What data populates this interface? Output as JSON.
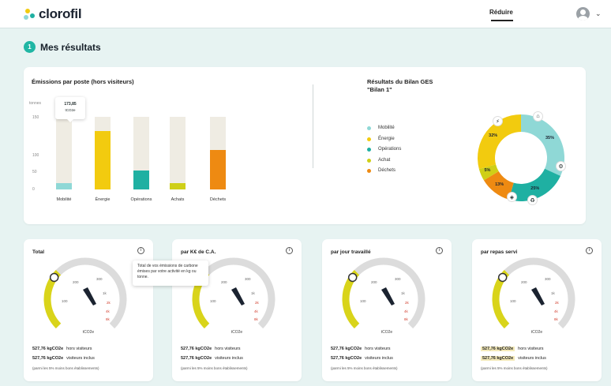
{
  "app": {
    "name": "clorofil"
  },
  "header": {
    "reduce_label": "Réduire"
  },
  "page": {
    "step": "1",
    "title": "Mes résultats"
  },
  "emissions": {
    "title": "Émissions par poste (hors visiteurs)",
    "y_ticks": [
      "tonnes",
      "150",
      "100",
      "50",
      "0"
    ],
    "tooltip": {
      "value": "173,85",
      "unit": "tCO2e"
    }
  },
  "ges": {
    "title_line1": "Résultats du Bilan GES",
    "title_line2": "\"Bilan 1\"",
    "legend": [
      {
        "label": "Mobilité",
        "color": "#8fd8d6"
      },
      {
        "label": "Énergie",
        "color": "#f2cb0f"
      },
      {
        "label": "Opérations",
        "color": "#1fb0a2"
      },
      {
        "label": "Achat",
        "color": "#cfcf17"
      },
      {
        "label": "Déchets",
        "color": "#ee8a12"
      }
    ]
  },
  "chart_data": [
    {
      "type": "bar",
      "title": "Émissions par poste (hors visiteurs)",
      "ylabel": "tonnes",
      "ylim": [
        0,
        180
      ],
      "categories": [
        "Mobilité",
        "Énergie",
        "Opérations",
        "Achats",
        "Déchets"
      ],
      "values": [
        15,
        140,
        45,
        15,
        95
      ],
      "background_values": [
        175,
        175,
        175,
        175,
        175
      ],
      "colors": [
        "#8fd8d6",
        "#f2cb0f",
        "#1fb0a2",
        "#cfcf17",
        "#ee8a12"
      ]
    },
    {
      "type": "pie",
      "title": "Résultats du Bilan GES \"Bilan 1\"",
      "categories": [
        "Mobilité",
        "Opérations",
        "Déchets",
        "Achat",
        "Énergie"
      ],
      "values": [
        35,
        25,
        13,
        5,
        32
      ],
      "labels": [
        "35%",
        "25%",
        "13%",
        "5%",
        "32%"
      ],
      "colors": [
        "#8fd8d6",
        "#1fb0a2",
        "#ee8a12",
        "#cfcf17",
        "#f2cb0f"
      ]
    }
  ],
  "gauge_ticks": [
    "200",
    "300",
    "100",
    "1k",
    "2k",
    "4k",
    "8k"
  ],
  "gauges": [
    {
      "title": "Total",
      "unit": "tCO2e",
      "line1_value": "527,76 kgCO2e",
      "line1_label": "hors visiteurs",
      "line2_value": "527,76 kgCO2e",
      "line2_label": "visiteurs inclus",
      "footnote": "(parmi les 5% moins bons établissements)",
      "tooltip": "Total de vos émissions de carbone émises par votre activité en kg ou tonne."
    },
    {
      "title": "par K€ de C.A.",
      "unit": "tCO2e",
      "line1_value": "527,76 kgCO2e",
      "line1_label": "hors visiteurs",
      "line2_value": "527,76 kgCO2e",
      "line2_label": "visiteurs inclus",
      "footnote": "(parmi les 5% moins bons établissements)"
    },
    {
      "title": "par jour travaillé",
      "unit": "tCO2e",
      "line1_value": "527,76 kgCO2e",
      "line1_label": "hors visiteurs",
      "line2_value": "527,76 kgCO2e",
      "line2_label": "visiteurs inclus",
      "footnote": "(parmi les 5% moins bons établissements)"
    },
    {
      "title": "par repas servi",
      "unit": "tCO2e",
      "line1_value": "527,76 kgCO2e",
      "line1_label": "hors visiteurs",
      "line2_value": "527,76 kgCO2e",
      "line2_label": "visiteurs inclus",
      "footnote": "(parmi les 5% moins bons établissements)"
    }
  ]
}
